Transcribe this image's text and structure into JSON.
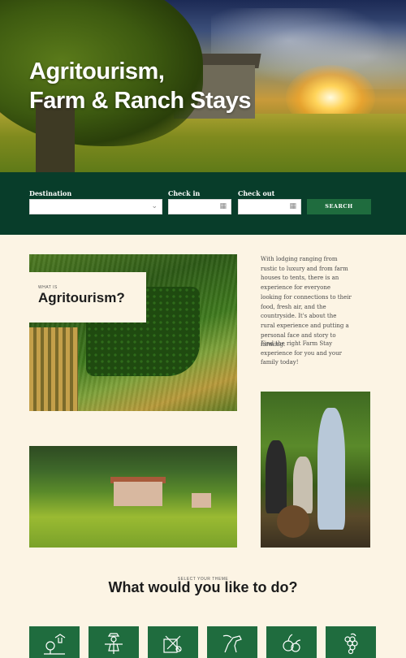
{
  "hero": {
    "title_line1": "Agritourism,",
    "title_line2": "Farm & Ranch Stays"
  },
  "search": {
    "destination_label": "Destination",
    "destination_value": "",
    "checkin_label": "Check in",
    "checkin_value": "",
    "checkout_label": "Check out",
    "checkout_value": "",
    "button_label": "SEARCH",
    "dropdown_icon": "chevron-down-icon",
    "calendar_icon": "calendar-icon"
  },
  "about": {
    "kicker": "WHAT IS",
    "heading": "Agritourism?",
    "paragraph1": "With lodging ranging from rustic to luxury and from farm houses to tents, there is an experience for everyone looking for connections to their food, fresh air, and the countryside. It's about the rural experience and putting a personal face and story to farming.",
    "paragraph2": "Find the right Farm Stay experience for you and your family today!"
  },
  "themes": {
    "kicker": "SELECT YOUR THEME",
    "heading": "What would you like to do?",
    "tiles": [
      {
        "icon": "farm-tree-icon"
      },
      {
        "icon": "scarecrow-icon"
      },
      {
        "icon": "garden-tools-icon"
      },
      {
        "icon": "horse-ranch-icon"
      },
      {
        "icon": "vegetables-icon"
      },
      {
        "icon": "grapes-icon"
      }
    ]
  },
  "colors": {
    "search_bg": "#083d2a",
    "button_green": "#1f6c3e",
    "page_bg": "#fcf4e4"
  }
}
